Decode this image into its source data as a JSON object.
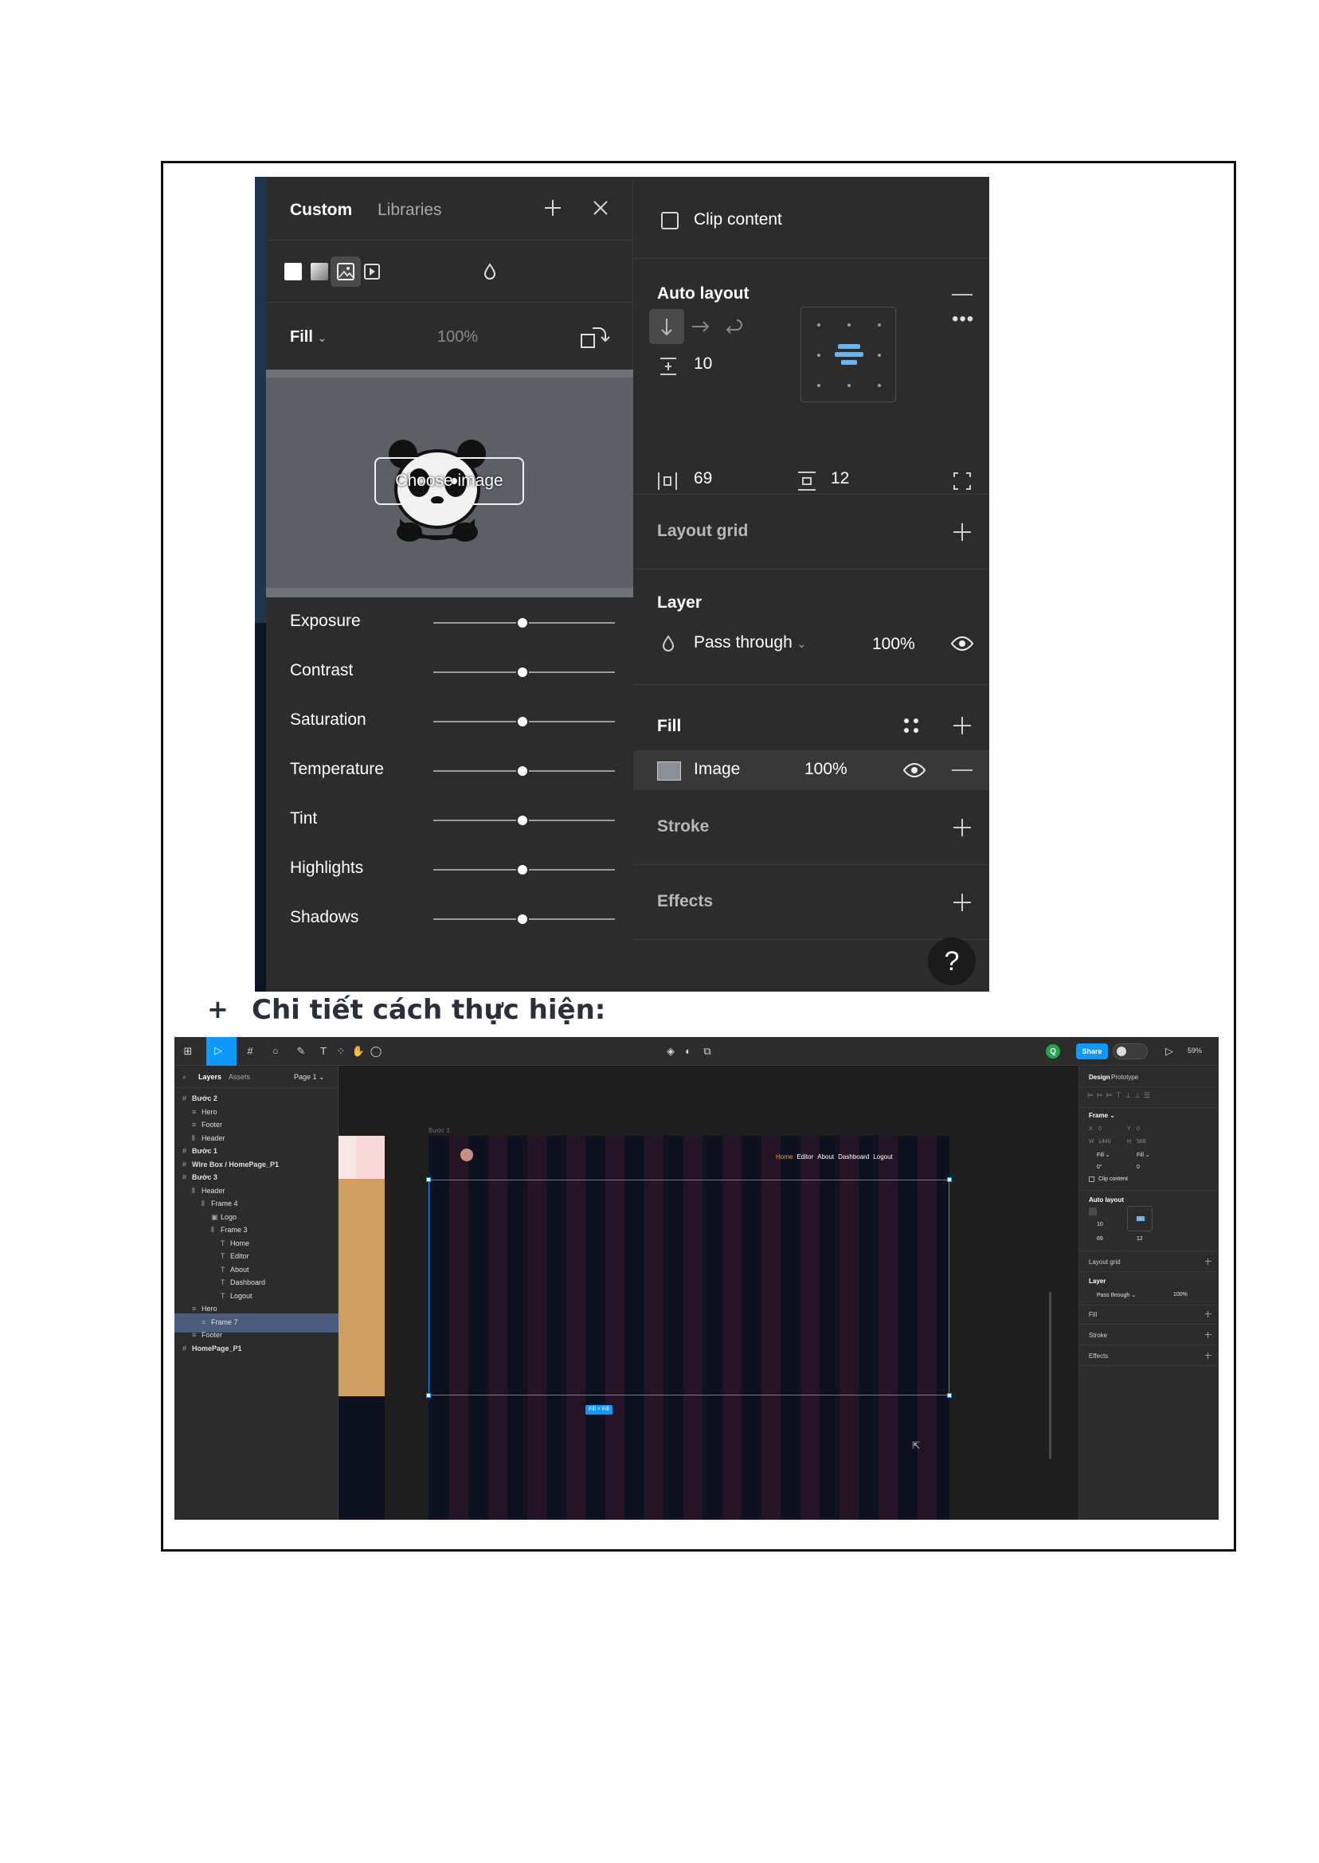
{
  "heading": {
    "bullet": "+",
    "text": "Chi tiết cách thực hiện:"
  },
  "picker": {
    "tabs": [
      "Custom",
      "Libraries"
    ],
    "fill_mode": "Fill",
    "fill_opacity": "100%",
    "choose_image": "Choose image",
    "adjustments": [
      {
        "label": "Exposure",
        "value": 0.5
      },
      {
        "label": "Contrast",
        "value": 0.5
      },
      {
        "label": "Saturation",
        "value": 0.5
      },
      {
        "label": "Temperature",
        "value": 0.5
      },
      {
        "label": "Tint",
        "value": 0.5
      },
      {
        "label": "Highlights",
        "value": 0.5
      },
      {
        "label": "Shadows",
        "value": 0.5
      }
    ]
  },
  "design": {
    "clip_content": "Clip content",
    "auto_layout": "Auto layout",
    "gap": "10",
    "padding_h": "69",
    "padding_v": "12",
    "layout_grid": "Layout grid",
    "layer": "Layer",
    "blend_mode": "Pass through",
    "layer_opacity": "100%",
    "fill": "Fill",
    "fill_item": "Image",
    "fill_item_opacity": "100%",
    "stroke": "Stroke",
    "effects": "Effects",
    "help": "?"
  },
  "figma": {
    "share": "Share",
    "avatar": "Q",
    "zoom": "59%",
    "layers_tab": "Layers",
    "assets_tab": "Assets",
    "page": "Page 1",
    "layers": [
      {
        "name": "Bước 2",
        "icon": "#",
        "bold": true
      },
      {
        "name": "Hero",
        "icon": "≡",
        "bold": false
      },
      {
        "name": "Footer",
        "icon": "≡",
        "bold": false
      },
      {
        "name": "Header",
        "icon": "⫴",
        "bold": false
      },
      {
        "name": "Bước 1",
        "icon": "#",
        "bold": true
      },
      {
        "name": "Wire Box / HomePage_P1",
        "icon": "#",
        "bold": true
      },
      {
        "name": "Bước 3",
        "icon": "#",
        "bold": true
      },
      {
        "name": "Header",
        "icon": "⫴",
        "bold": false
      },
      {
        "name": "Frame 4",
        "icon": "⫴",
        "bold": false
      },
      {
        "name": "Logo",
        "icon": "▣",
        "bold": false
      },
      {
        "name": "Frame 3",
        "icon": "⫴",
        "bold": false
      },
      {
        "name": "Home",
        "icon": "T",
        "bold": false
      },
      {
        "name": "Editor",
        "icon": "T",
        "bold": false
      },
      {
        "name": "About",
        "icon": "T",
        "bold": false
      },
      {
        "name": "Dashboard",
        "icon": "T",
        "bold": false
      },
      {
        "name": "Logout",
        "icon": "T",
        "bold": false
      },
      {
        "name": "Hero",
        "icon": "≡",
        "bold": false
      },
      {
        "name": "Frame 7",
        "icon": "≡",
        "bold": false,
        "selected": true
      },
      {
        "name": "Footer",
        "icon": "≡",
        "bold": false
      },
      {
        "name": "HomePage_P1",
        "icon": "#",
        "bold": true
      }
    ],
    "frame_label": "Bước 3",
    "nav": [
      "Home",
      "Editor",
      "About",
      "Dashboard",
      "Logout"
    ],
    "size_tag": "Fill × Fill",
    "panel": {
      "tabs": [
        "Design",
        "Prototype"
      ],
      "frame": "Frame",
      "x": "0",
      "y": "0",
      "w": "1440",
      "h": "588",
      "w_mode": "Fill",
      "h_mode": "Fill",
      "rotation": "0°",
      "radius": "0",
      "clip": "Clip content",
      "auto_layout": "Auto layout",
      "gap": "10",
      "pad_h": "69",
      "pad_v": "12",
      "layout_grid": "Layout grid",
      "layer": "Layer",
      "blend": "Pass through",
      "opacity": "100%",
      "fill": "Fill",
      "stroke": "Stroke",
      "effects": "Effects"
    }
  }
}
